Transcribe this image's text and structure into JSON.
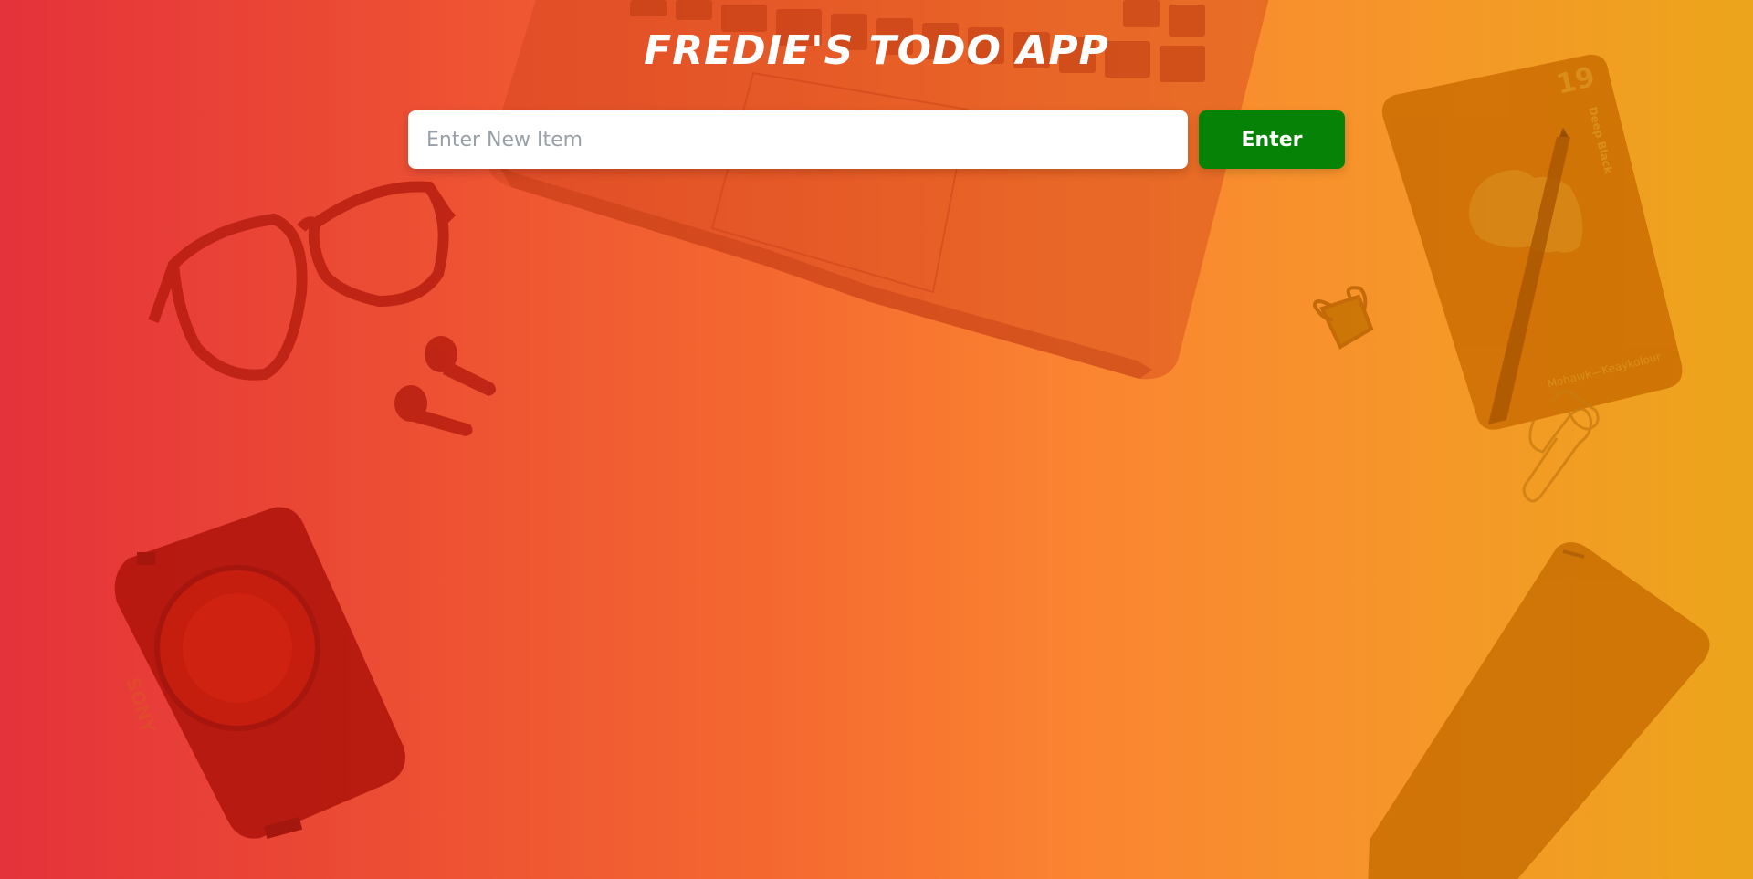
{
  "app": {
    "title": "FREDIE'S TODO APP"
  },
  "form": {
    "input_placeholder": "Enter New Item",
    "input_value": "",
    "submit_label": "Enter"
  },
  "background": {
    "description_icons": [
      "laptop-icon",
      "glasses-icon",
      "earbuds-icon",
      "camera-icon",
      "notebook-icon",
      "pen-icon",
      "binder-clip-icon",
      "paper-clip-icon",
      "phone-icon"
    ],
    "camera_brand": "SONY",
    "notebook_number": "19",
    "notebook_subtitle": "Deep Black",
    "notebook_footer": "Mohawk—Keaykolour"
  },
  "colors": {
    "gradient_start": "#e5323b",
    "gradient_end": "#eca51b",
    "title_text": "#ffffff",
    "button_bg": "#068306",
    "button_text": "#ffffff",
    "input_bg": "#ffffff"
  }
}
